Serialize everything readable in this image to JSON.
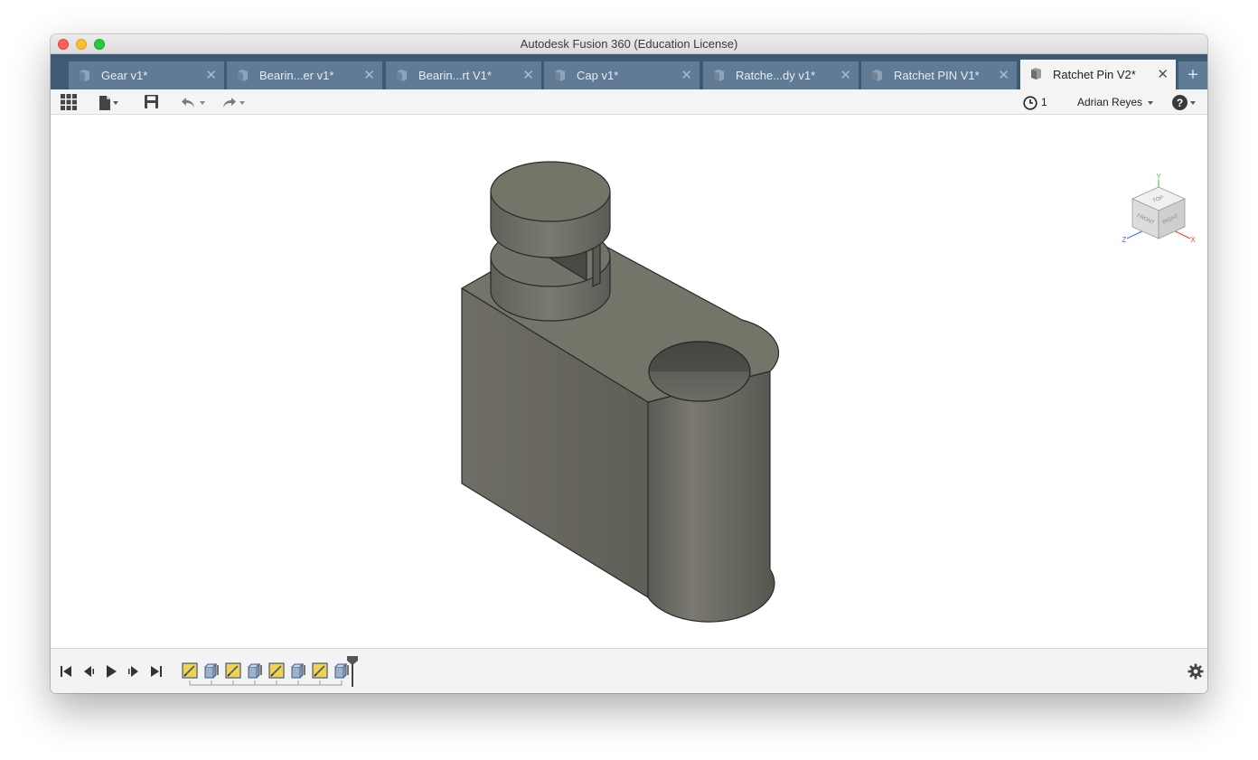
{
  "window": {
    "title": "Autodesk Fusion 360 (Education License)"
  },
  "tabs": [
    {
      "label": "Gear v1*",
      "active": false
    },
    {
      "label": "Bearin...er v1*",
      "active": false
    },
    {
      "label": "Bearin...rt V1*",
      "active": false
    },
    {
      "label": "Cap v1*",
      "active": false
    },
    {
      "label": "Ratche...dy v1*",
      "active": false
    },
    {
      "label": "Ratchet PIN V1*",
      "active": false
    },
    {
      "label": "Ratchet Pin V2*",
      "active": true
    }
  ],
  "toolbar": {
    "jobs_count": "1",
    "user_name": "Adrian Reyes"
  },
  "viewcube": {
    "faces": {
      "top": "TOP",
      "front": "FRONT",
      "right": "RIGHT"
    },
    "axes": {
      "x": "X",
      "y": "Y",
      "z": "Z"
    },
    "axis_colors": {
      "x": "#e8473b",
      "y": "#4ec44e",
      "z": "#4b6fe8"
    }
  },
  "timeline": {
    "features": [
      "sketch",
      "extrude",
      "sketch",
      "extrude",
      "sketch",
      "extrude",
      "sketch",
      "extrude"
    ]
  },
  "colors": {
    "tab_bar": "#3f5a73",
    "tab_inactive": "#5f7b95",
    "model_body": "#6b6a62"
  }
}
